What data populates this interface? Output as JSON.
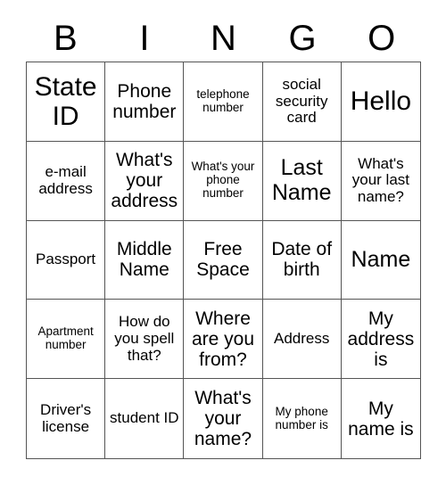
{
  "card": {
    "header_letters": [
      "B",
      "I",
      "N",
      "G",
      "O"
    ],
    "columns": 5,
    "rows": 5,
    "border_color": "#555555",
    "background_color": "#ffffff",
    "text_color": "#000000",
    "cells": [
      {
        "text": "State ID",
        "size": "fs-xl"
      },
      {
        "text": "Phone number",
        "size": "fs-md"
      },
      {
        "text": "telephone number",
        "size": "fs-xs"
      },
      {
        "text": "social security card",
        "size": "fs-sm"
      },
      {
        "text": "Hello",
        "size": "fs-xl"
      },
      {
        "text": "e-mail address",
        "size": "fs-sm"
      },
      {
        "text": "What's your address",
        "size": "fs-md"
      },
      {
        "text": "What's your phone number",
        "size": "fs-xs"
      },
      {
        "text": "Last Name",
        "size": "fs-lg"
      },
      {
        "text": "What's your last name?",
        "size": "fs-sm"
      },
      {
        "text": "Passport",
        "size": "fs-sm"
      },
      {
        "text": "Middle Name",
        "size": "fs-md"
      },
      {
        "text": "Free Space",
        "size": "fs-md"
      },
      {
        "text": "Date of birth",
        "size": "fs-md"
      },
      {
        "text": "Name",
        "size": "fs-lg"
      },
      {
        "text": "Apartment number",
        "size": "fs-xs"
      },
      {
        "text": "How do you spell that?",
        "size": "fs-sm"
      },
      {
        "text": "Where are you from?",
        "size": "fs-md"
      },
      {
        "text": "Address",
        "size": "fs-sm"
      },
      {
        "text": "My address is",
        "size": "fs-md"
      },
      {
        "text": "Driver's license",
        "size": "fs-sm"
      },
      {
        "text": "student ID",
        "size": "fs-sm"
      },
      {
        "text": "What's your name?",
        "size": "fs-md"
      },
      {
        "text": "My phone number is",
        "size": "fs-xs"
      },
      {
        "text": "My name is",
        "size": "fs-md"
      }
    ]
  }
}
